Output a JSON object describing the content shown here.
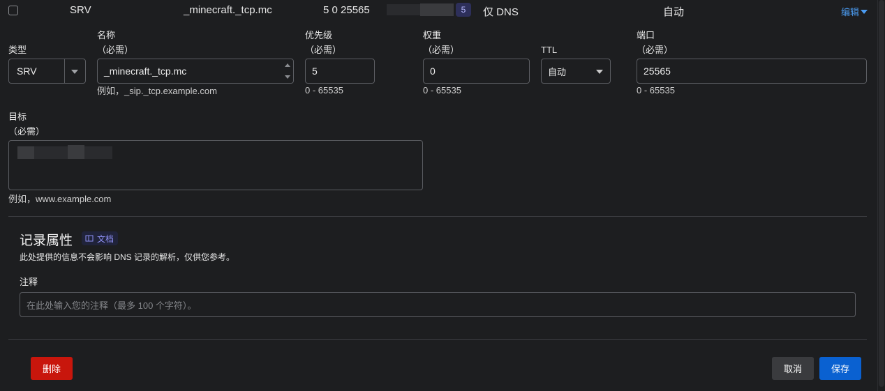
{
  "record_row": {
    "type": "SRV",
    "name": "_minecraft._tcp.mc",
    "content_prefix": "5 0 25565",
    "count_badge": "5",
    "proxy_status": "仅 DNS",
    "ttl": "自动",
    "edit_label": "编辑"
  },
  "form": {
    "type": {
      "label": "类型",
      "value": "SRV"
    },
    "name": {
      "label": "名称",
      "required": "（必需）",
      "value": "_minecraft._tcp.mc",
      "hint": "例如，_sip._tcp.example.com"
    },
    "priority": {
      "label": "优先级",
      "required": "（必需）",
      "value": "5",
      "range": "0 - 65535"
    },
    "weight": {
      "label": "权重",
      "required": "（必需）",
      "value": "0",
      "range": "0 - 65535"
    },
    "ttl": {
      "label": "TTL",
      "value": "自动"
    },
    "port": {
      "label": "端口",
      "required": "（必需）",
      "value": "25565",
      "range": "0 - 65535"
    },
    "target": {
      "label": "目标",
      "required": "（必需）",
      "hint": "例如，www.example.com"
    }
  },
  "attributes": {
    "title": "记录属性",
    "docs_label": "文档",
    "description": "此处提供的信息不会影响 DNS 记录的解析，仅供您参考。",
    "comment_label": "注释",
    "comment_placeholder": "在此处输入您的注释（最多 100 个字符）。"
  },
  "actions": {
    "delete_label": "删除",
    "cancel_label": "取消",
    "save_label": "保存"
  },
  "colors": {
    "delete": "#c8160c",
    "save": "#0a61d1",
    "cancel": "#3a3b3e",
    "edit_link": "#4b9cf2",
    "badge_bg": "#2d2f5a",
    "badge_text": "#b7b9ff"
  }
}
